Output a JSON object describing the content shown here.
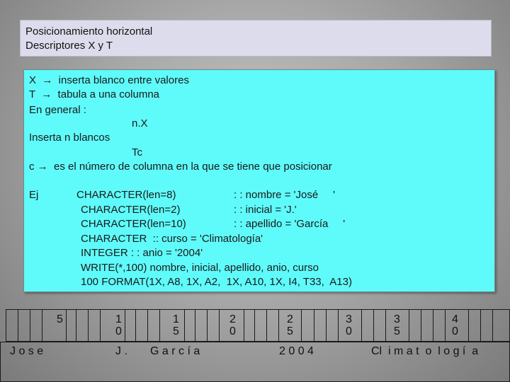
{
  "title": {
    "line1": "Posicionamiento horizontal",
    "line2": "Descriptores  X  y T"
  },
  "content": {
    "lines": [
      "X  →  inserta blanco entre valores",
      "T  →  tabula a una columna",
      "En general :",
      "n.X",
      "Inserta n blancos",
      "Tc",
      "c →  es el número de columna en la que se tiene que posicionar"
    ],
    "example": {
      "label": "Ej",
      "code": [
        [
          "CHARACTER(len=8)",
          ": : nombre = 'José     '"
        ],
        [
          "CHARACTER(len=2)",
          ": : inicial = 'J.'"
        ],
        [
          "CHARACTER(len=10)",
          ": : apellido = 'García     '"
        ],
        [
          "CHARACTER  :: curso = 'Climatología'",
          ""
        ],
        [
          "INTEGER : : anio = '2004'",
          ""
        ],
        [
          "WRITE(*,100) nombre, inicial, apellido, anio, curso",
          ""
        ],
        [
          "100 FORMAT(1X, A8, 1X, A2,  1X, A10, 1X, I4, T33,  A13)",
          ""
        ]
      ]
    }
  },
  "ruler": {
    "marks": [
      {
        "top": "",
        "bottom": "5"
      },
      {
        "top": "1",
        "bottom": "0"
      },
      {
        "top": "1",
        "bottom": "5"
      },
      {
        "top": "2",
        "bottom": "0"
      },
      {
        "top": "2",
        "bottom": "5"
      },
      {
        "top": "3",
        "bottom": "0"
      },
      {
        "top": "3",
        "bottom": "5"
      },
      {
        "top": "4",
        "bottom": "0"
      }
    ],
    "output": [
      "J o s e",
      "J .",
      "G a r c í a",
      "2 0 0 4",
      "Cl  i m a t  o  l o g í  a"
    ]
  }
}
